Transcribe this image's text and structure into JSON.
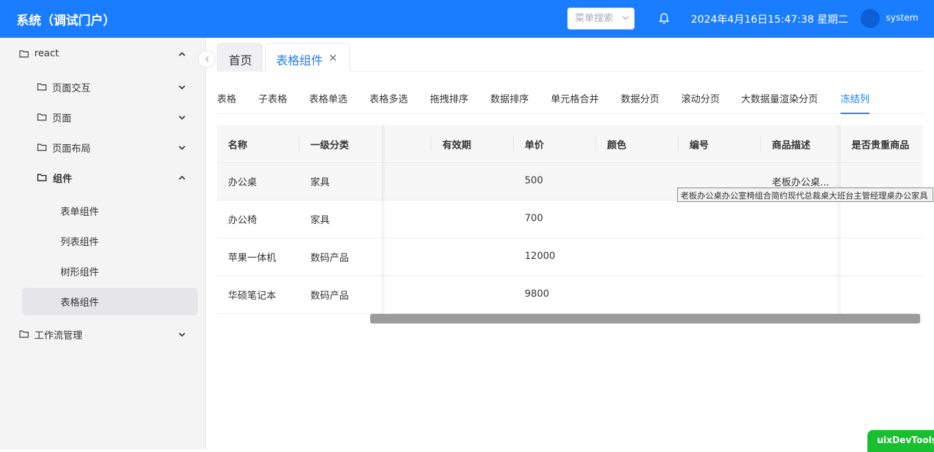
{
  "header": {
    "title": "系统（调试门户）",
    "search_placeholder": "菜单搜索",
    "datetime": "2024年4月16日15:47:38 星期二",
    "username": "system",
    "brand_color": "#1a7cff"
  },
  "sidebar": {
    "items": [
      {
        "label": "react"
      },
      {
        "label": "页面交互"
      },
      {
        "label": "页面"
      },
      {
        "label": "页面布局"
      },
      {
        "label": "组件"
      },
      {
        "label": "表单组件"
      },
      {
        "label": "列表组件"
      },
      {
        "label": "树形组件"
      },
      {
        "label": "表格组件"
      },
      {
        "label": "工作流管理"
      }
    ],
    "active_item": "表格组件"
  },
  "tabs": {
    "home": "首页",
    "current": "表格组件"
  },
  "subtabs": {
    "items": [
      "表格",
      "子表格",
      "表格单选",
      "表格多选",
      "拖拽排序",
      "数据排序",
      "单元格合并",
      "数据分页",
      "滚动分页",
      "大数据量渲染分页",
      "冻结列"
    ],
    "active": "冻结列"
  },
  "table": {
    "columns": [
      "名称",
      "一级分类",
      "有效期",
      "单价",
      "颜色",
      "编号",
      "商品描述",
      "是否贵重商品"
    ],
    "rows": [
      {
        "name": "办公桌",
        "category": "家具",
        "price": "500",
        "desc": "老板办公桌..."
      },
      {
        "name": "办公椅",
        "category": "家具",
        "price": "700",
        "desc": ""
      },
      {
        "name": "苹果一体机",
        "category": "数码产品",
        "price": "12000",
        "desc": ""
      },
      {
        "name": "华硕笔记本",
        "category": "数码产品",
        "price": "9800",
        "desc": ""
      }
    ],
    "tooltip": "老板办公桌办公室椅组合简约现代总裁桌大班台主管经理桌办公家具"
  },
  "devtools": {
    "label": "uixDevTools"
  }
}
